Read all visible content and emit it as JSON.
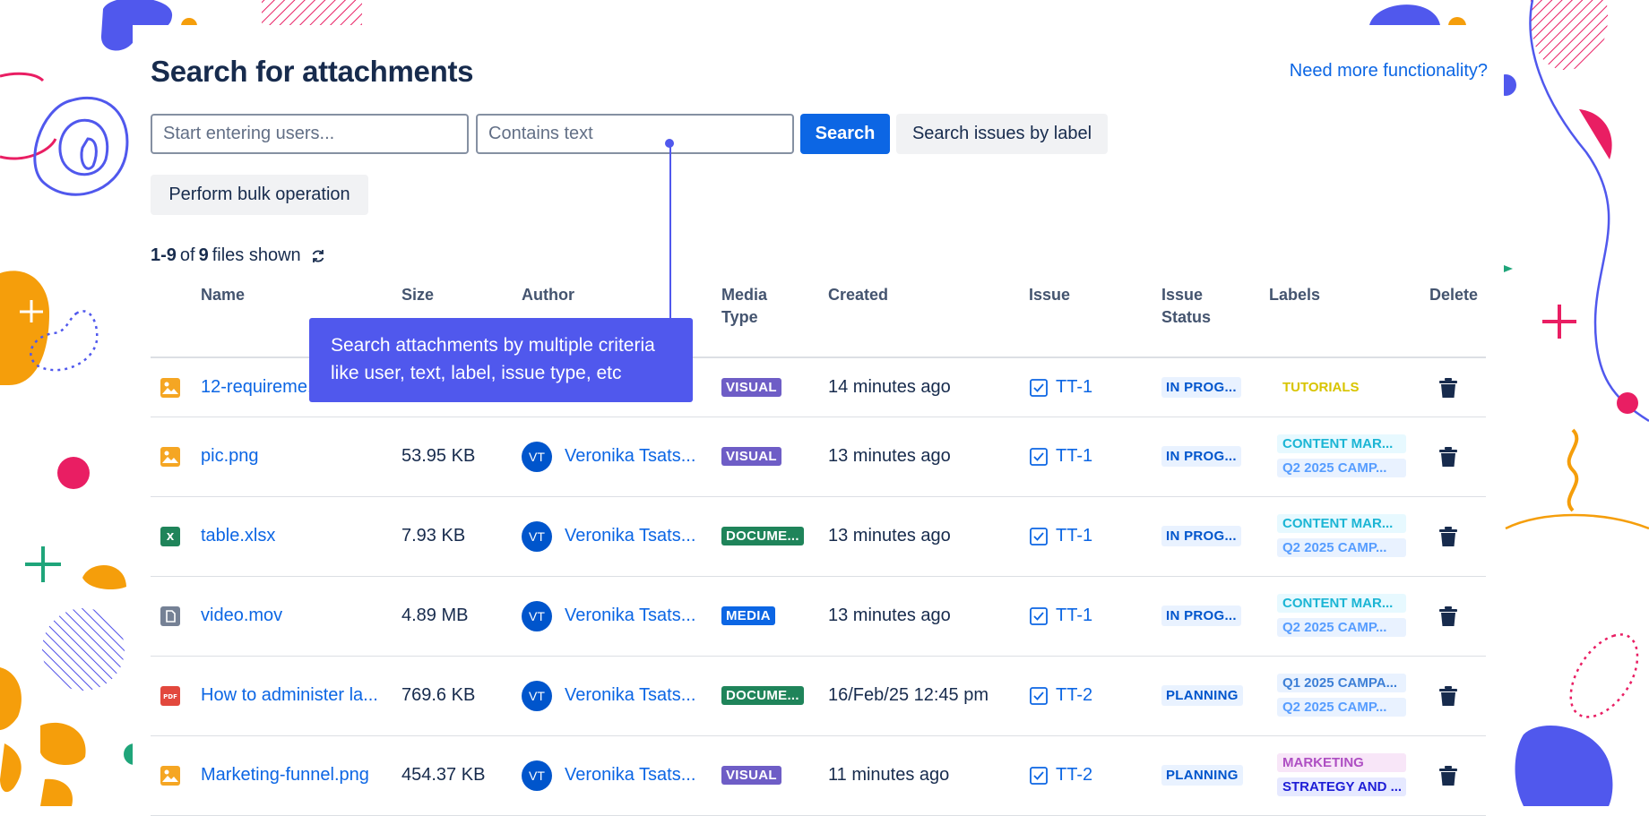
{
  "header": {
    "title": "Search for attachments",
    "help_link": "Need more functionality?"
  },
  "search": {
    "users_placeholder": "Start entering users...",
    "text_placeholder": "Contains text",
    "search_button": "Search",
    "label_button": "Search issues by label",
    "bulk_button": "Perform bulk operation"
  },
  "summary": {
    "range": "1-9",
    "of": "of",
    "total": "9",
    "suffix": "files shown"
  },
  "columns": [
    "Name",
    "Size",
    "Author",
    "Media Type",
    "Created",
    "Issue",
    "Issue Status",
    "Labels",
    "Delete"
  ],
  "rows": [
    {
      "icon": "image-icon",
      "name": "12-requireme...",
      "size": "",
      "author": "",
      "media": "VISUAL",
      "created": "14 minutes ago",
      "issue": "TT-1",
      "status": "IN PROG...",
      "labels": [
        "TUTORIALS"
      ]
    },
    {
      "icon": "image-icon",
      "name": "pic.png",
      "size": "53.95 KB",
      "author": "Veronika Tsats...",
      "media": "VISUAL",
      "created": "13 minutes ago",
      "issue": "TT-1",
      "status": "IN PROG...",
      "labels": [
        "CONTENT MAR...",
        "Q2 2025 CAMP..."
      ]
    },
    {
      "icon": "spreadsheet-icon",
      "name": "table.xlsx",
      "size": "7.93 KB",
      "author": "Veronika Tsats...",
      "media": "DOCUME...",
      "created": "13 minutes ago",
      "issue": "TT-1",
      "status": "IN PROG...",
      "labels": [
        "CONTENT MAR...",
        "Q2 2025 CAMP..."
      ]
    },
    {
      "icon": "file-icon",
      "name": "video.mov",
      "size": "4.89 MB",
      "author": "Veronika Tsats...",
      "media": "MEDIA",
      "created": "13 minutes ago",
      "issue": "TT-1",
      "status": "IN PROG...",
      "labels": [
        "CONTENT MAR...",
        "Q2 2025 CAMP..."
      ]
    },
    {
      "icon": "pdf-icon",
      "name": "How to administer la...",
      "size": "769.6 KB",
      "author": "Veronika Tsats...",
      "media": "DOCUME...",
      "created": "16/Feb/25 12:45 pm",
      "issue": "TT-2",
      "status": "PLANNING",
      "labels": [
        "Q1 2025 CAMPA...",
        "Q2 2025 CAMP..."
      ]
    },
    {
      "icon": "image-icon",
      "name": "Marketing-funnel.png",
      "size": "454.37 KB",
      "author": "Veronika Tsats...",
      "media": "VISUAL",
      "created": "11 minutes ago",
      "issue": "TT-2",
      "status": "PLANNING",
      "labels": [
        "MARKETING",
        "STRATEGY AND ..."
      ]
    }
  ],
  "avatar_initials": "VT",
  "tooltip": {
    "line1": "Search attachments by multiple criteria",
    "line2": "like user, text, label, issue type, etc"
  },
  "colors": {
    "accent": "#0c66e4",
    "tooltip": "#5058ed",
    "visual": "#6e5dc6",
    "document": "#1f845a",
    "media": "#0c66e4"
  }
}
